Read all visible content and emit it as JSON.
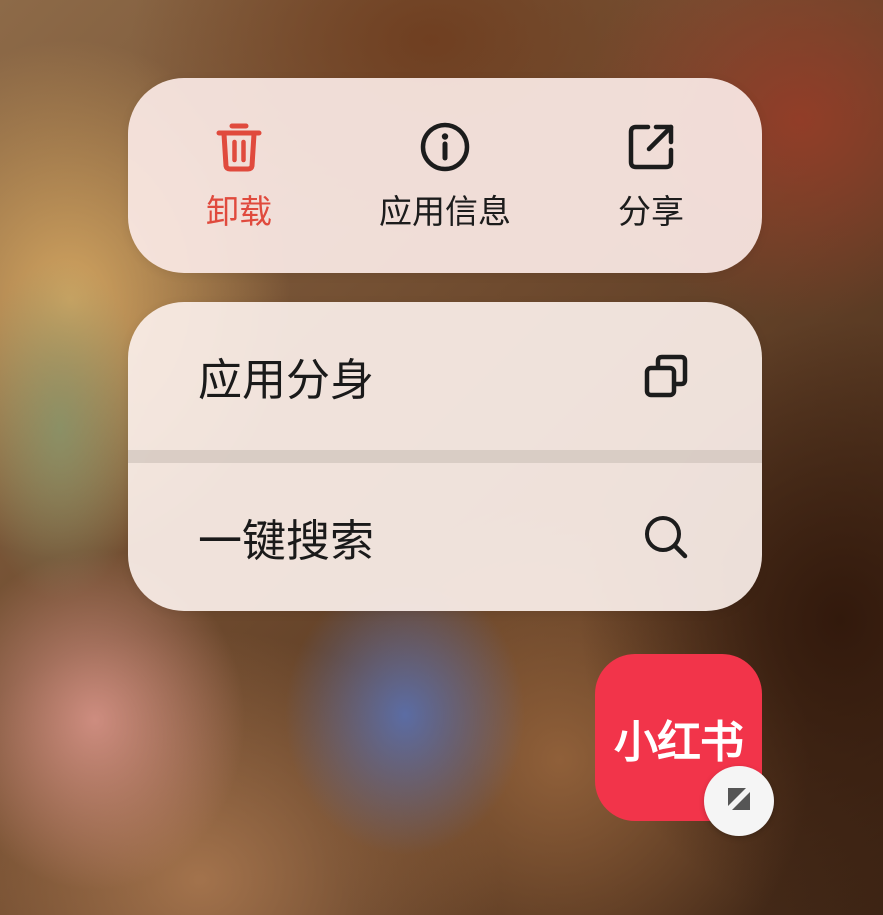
{
  "quick_actions": [
    {
      "label": "卸载",
      "icon": "trash-icon",
      "color": "#e04a3d"
    },
    {
      "label": "应用信息",
      "icon": "info-icon",
      "color": "#1c1c1c"
    },
    {
      "label": "分享",
      "icon": "share-icon",
      "color": "#1c1c1c"
    }
  ],
  "menu_items": [
    {
      "label": "应用分身",
      "icon": "clone-icon"
    },
    {
      "label": "一键搜索",
      "icon": "search-icon"
    }
  ],
  "app": {
    "name": "小红书",
    "color": "#f2344a",
    "badge_icon": "resize-icon"
  }
}
